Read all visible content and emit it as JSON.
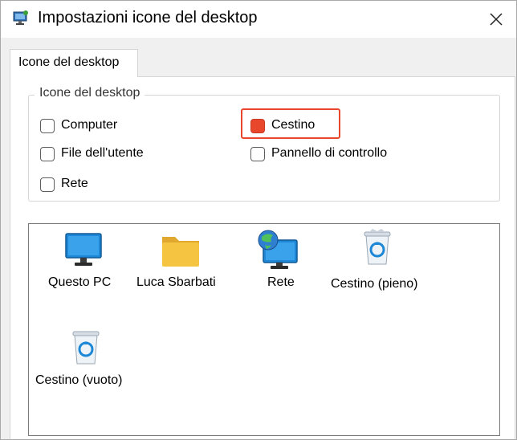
{
  "window": {
    "title": "Impostazioni icone del desktop",
    "tab_label": "Icone del desktop"
  },
  "group": {
    "legend": "Icone del desktop",
    "checkboxes": [
      {
        "label": "Computer",
        "checked": false
      },
      {
        "label": "Cestino",
        "checked": false,
        "highlighted": true
      },
      {
        "label": "File dell'utente",
        "checked": false
      },
      {
        "label": "Pannello di controllo",
        "checked": false
      },
      {
        "label": "Rete",
        "checked": false
      }
    ]
  },
  "icons": [
    {
      "label": "Questo PC",
      "icon": "monitor-icon"
    },
    {
      "label": "Luca Sbarbati",
      "icon": "folder-icon"
    },
    {
      "label": "Rete",
      "icon": "network-globe-icon"
    },
    {
      "label": "Cestino (pieno)",
      "icon": "recycle-bin-full-icon"
    },
    {
      "label": "Cestino (vuoto)",
      "icon": "recycle-bin-empty-icon"
    }
  ],
  "colors": {
    "highlight": "#e8472b",
    "monitor_blue": "#1e88d6",
    "folder_yellow": "#f5c542"
  }
}
